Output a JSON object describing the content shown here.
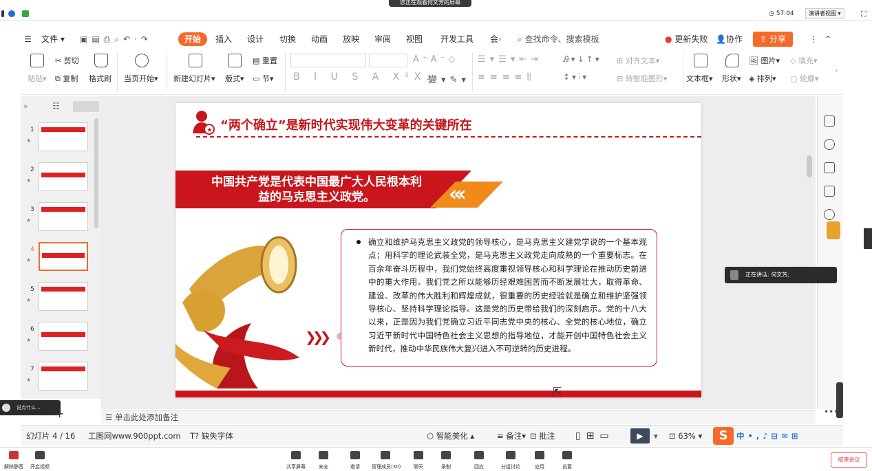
{
  "meeting": {
    "banner": "您正在观看何文芳的屏幕",
    "timer": "57:04",
    "view_mode": "演讲者视图",
    "speaking_label": "正在讲话: 何文芳;",
    "left_chip": "说点什么...",
    "toolbar": [
      {
        "label": "解除静音",
        "icon": "mic-icon"
      },
      {
        "label": "开启视频",
        "icon": "camera-icon"
      },
      {
        "label": "共享屏幕",
        "icon": "share-screen-icon"
      },
      {
        "label": "安全",
        "icon": "shield-icon"
      },
      {
        "label": "邀请",
        "icon": "invite-icon"
      },
      {
        "label": "管理成员(30)",
        "icon": "members-icon"
      },
      {
        "label": "聊天",
        "icon": "chat-icon"
      },
      {
        "label": "录制",
        "icon": "record-icon"
      },
      {
        "label": "回应",
        "icon": "reaction-icon"
      },
      {
        "label": "分组讨论",
        "icon": "breakout-icon"
      },
      {
        "label": "应用",
        "icon": "apps-icon"
      },
      {
        "label": "设置",
        "icon": "gear-icon"
      }
    ],
    "end_label": "结束会议"
  },
  "menu": {
    "file": "文件",
    "tabs": [
      "开始",
      "插入",
      "设计",
      "切换",
      "动画",
      "放映",
      "审阅",
      "视图",
      "开发工具",
      "会"
    ],
    "search_placeholder": "查找命令、搜索模板",
    "update_fail": "更新失败",
    "collab": "协作",
    "share": "分享"
  },
  "ribbon": {
    "paste": "粘贴",
    "cut": "剪切",
    "copy": "复制",
    "format_painter": "格式刷",
    "from_start": "当页开始",
    "new_slide": "新建幻灯片",
    "layout": "版式",
    "reset": "重置",
    "section": "节",
    "align_text": "对齐文本",
    "smart_art": "转智能图形",
    "textbox": "文本框",
    "shape": "形状",
    "picture": "图片",
    "arrange": "排列",
    "fill": "填充",
    "outline": "轮廓"
  },
  "slides": {
    "numbers": [
      "1",
      "2",
      "3",
      "4",
      "5",
      "6",
      "7"
    ],
    "current": 4
  },
  "slide": {
    "title": "“两个确立”是新时代实现伟大变革的关键所在",
    "banner_line1": "中国共产党是代表中国最广大人民根本利",
    "banner_line2": "益的马克思主义政党。",
    "body": "确立和维护马克思主义政党的领导核心，是马克思主义建党学说的一个基本观点；用科学的理论武装全党，是马克思主义政党走向成熟的一个重要标志。在百余年奋斗历程中，我们党始终高度重视领导核心和科学理论在推动历史前进中的重大作用。我们党之所以能够历经艰难困苦而不断发展壮大，取得革命、建设、改革的伟大胜利和辉煌成就，很重要的历史经验就是确立和维护坚强领导核心、坚持科学理论指导。这是党的历史带给我们的深刻启示。党的十八大以来，正是因为我们党确立习近平同志党中央的核心、全党的核心地位，确立习近平新时代中国特色社会主义思想的指导地位，才能开创中国特色社会主义新时代，推动中华民族伟大复兴进入不可逆转的历史进程。"
  },
  "notes_placeholder": "单击此处添加备注",
  "status": {
    "slide_count": "幻灯片 4 / 16",
    "site": "工图网www.900ppt.com",
    "missing_font": "缺失字体",
    "smart_beautify": "智能美化",
    "notes": "备注",
    "comments": "批注",
    "zoom": "63%"
  },
  "colors": {
    "accent_orange": "#f56a2a",
    "slide_red": "#c9151b",
    "banner_orange": "#f08b1a"
  }
}
